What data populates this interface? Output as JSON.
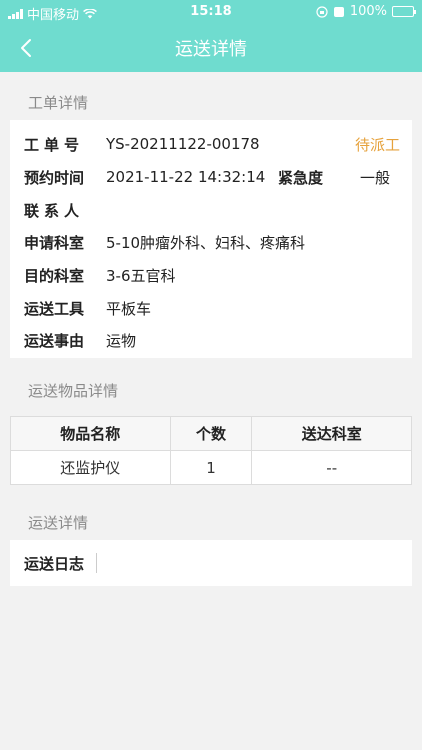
{
  "status_bar": {
    "carrier": "中国移动",
    "time": "15:18",
    "battery": "100%"
  },
  "nav": {
    "title": "运送详情",
    "back_icon": "chevron-left-icon"
  },
  "order_section": {
    "title": "工单详情",
    "order_no_label": "工单号",
    "order_no": "YS-20211122-00178",
    "status": "待派工",
    "appointment_label": "预约时间",
    "appointment_time": "2021-11-22 14:32:14",
    "urgency_label": "紧急度",
    "urgency": "一般",
    "contact_label": "联系人",
    "contact": "",
    "apply_dept_label": "申请科室",
    "apply_dept": "5-10肿瘤外科、妇科、疼痛科",
    "target_dept_label": "目的科室",
    "target_dept": "3-6五官科",
    "tool_label": "运送工具",
    "tool": "平板车",
    "reason_label": "运送事由",
    "reason": "运物"
  },
  "items_section": {
    "title": "运送物品详情",
    "headers": [
      "物品名称",
      "个数",
      "送达科室"
    ],
    "rows": [
      [
        "还监护仪",
        "1",
        "--"
      ]
    ]
  },
  "transport_section": {
    "title": "运送详情",
    "log_label": "运送日志",
    "log": ""
  },
  "colors": {
    "header": "#6fdccf",
    "status": "#e6a23c",
    "background": "#f2f2f2"
  }
}
